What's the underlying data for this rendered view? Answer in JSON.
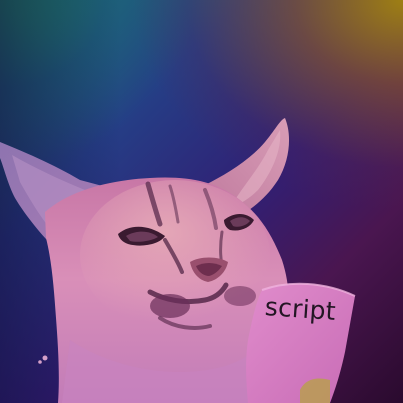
{
  "image": {
    "note_text": "script",
    "colors": {
      "top_left": "#1c7a72",
      "top_right": "#a4840e",
      "center": "#311f74",
      "bottom_right": "#2a0a2e",
      "fur_light": "#d98fb8",
      "fur_shadow": "#8a4a86",
      "paper": "#d77dc0"
    }
  }
}
